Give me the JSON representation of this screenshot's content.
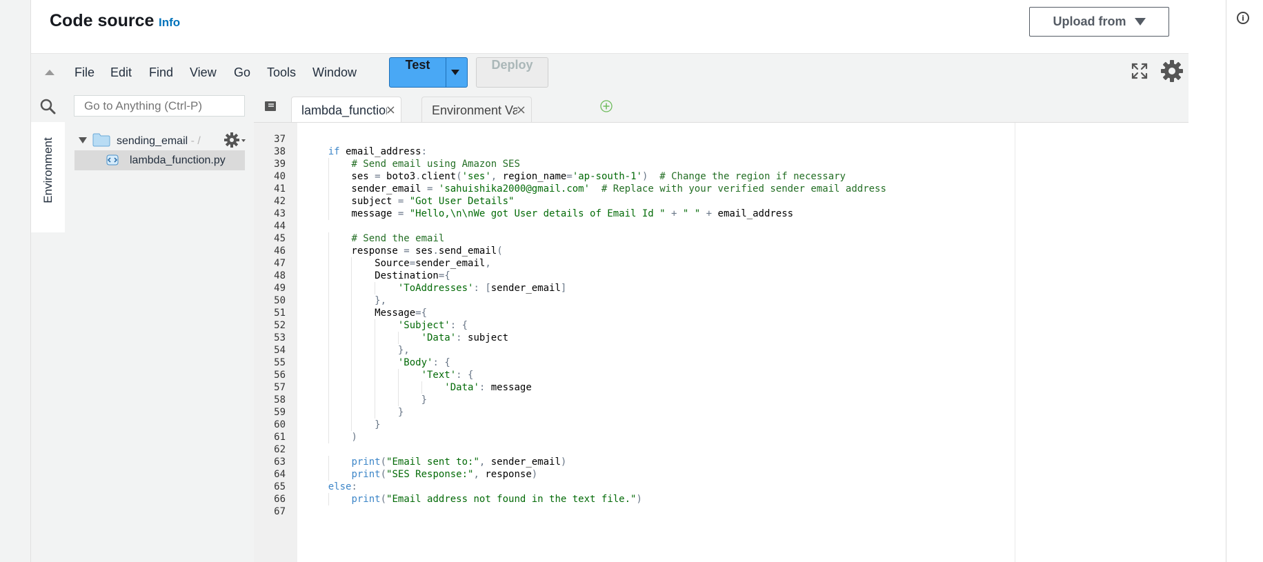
{
  "header": {
    "title": "Code source",
    "info_link": "Info",
    "upload_label": "Upload from"
  },
  "menu": {
    "items": [
      "File",
      "Edit",
      "Find",
      "View",
      "Go",
      "Tools",
      "Window"
    ],
    "test_label": "Test",
    "deploy_label": "Deploy"
  },
  "search": {
    "placeholder": "Go to Anything (Ctrl-P)"
  },
  "sidebar": {
    "environment_tab": "Environment",
    "folder_name": "sending_email",
    "folder_path": " - /",
    "file_name": "lambda_function.py"
  },
  "tabs": [
    {
      "label": "lambda_function",
      "close": "×"
    },
    {
      "label": "Environment Vari",
      "close": "×"
    }
  ],
  "code": [
    {
      "line": "37",
      "text": ""
    },
    {
      "line": "38",
      "text": "    if email_address:"
    },
    {
      "line": "39",
      "text": "        # Send email using Amazon SES"
    },
    {
      "line": "40",
      "text": "        ses = boto3.client('ses', region_name='ap-south-1')  # Change the region if necessary"
    },
    {
      "line": "41",
      "text": "        sender_email = 'sahuishika2000@gmail.com'  # Replace with your verified sender email address"
    },
    {
      "line": "42",
      "text": "        subject = \"Got User Details\""
    },
    {
      "line": "43",
      "text": "        message = \"Hello,\\n\\nWe got User details of Email Id \" + \" \" + email_address"
    },
    {
      "line": "44",
      "text": ""
    },
    {
      "line": "45",
      "text": "        # Send the email"
    },
    {
      "line": "46",
      "text": "        response = ses.send_email("
    },
    {
      "line": "47",
      "text": "            Source=sender_email,"
    },
    {
      "line": "48",
      "text": "            Destination={"
    },
    {
      "line": "49",
      "text": "                'ToAddresses': [sender_email]"
    },
    {
      "line": "50",
      "text": "            },"
    },
    {
      "line": "51",
      "text": "            Message={"
    },
    {
      "line": "52",
      "text": "                'Subject': {"
    },
    {
      "line": "53",
      "text": "                    'Data': subject"
    },
    {
      "line": "54",
      "text": "                },"
    },
    {
      "line": "55",
      "text": "                'Body': {"
    },
    {
      "line": "56",
      "text": "                    'Text': {"
    },
    {
      "line": "57",
      "text": "                        'Data': message"
    },
    {
      "line": "58",
      "text": "                    }"
    },
    {
      "line": "59",
      "text": "                }"
    },
    {
      "line": "60",
      "text": "            }"
    },
    {
      "line": "61",
      "text": "        )"
    },
    {
      "line": "62",
      "text": ""
    },
    {
      "line": "63",
      "text": "        print(\"Email sent to:\", sender_email)"
    },
    {
      "line": "64",
      "text": "        print(\"SES Response:\", response)"
    },
    {
      "line": "65",
      "text": "    else:"
    },
    {
      "line": "66",
      "text": "        print(\"Email address not found in the text file.\")"
    },
    {
      "line": "67",
      "text": ""
    }
  ]
}
